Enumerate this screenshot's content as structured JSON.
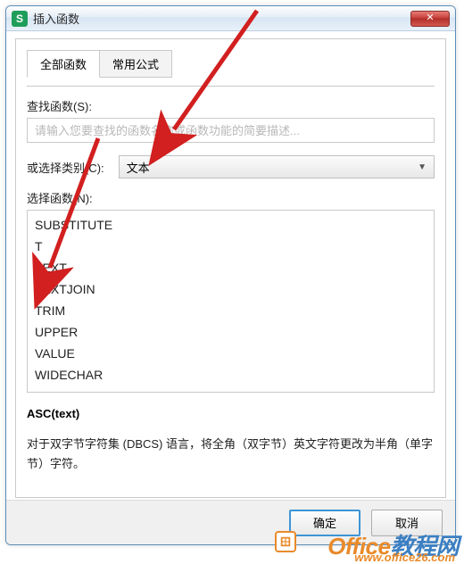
{
  "window": {
    "title": "插入函数",
    "app_icon_letter": "S"
  },
  "tabs": {
    "all": "全部函数",
    "common": "常用公式"
  },
  "search": {
    "label": "查找函数(S):",
    "placeholder": "请输入您要查找的函数名称或函数功能的简要描述..."
  },
  "category": {
    "label": "或选择类别(C):",
    "value": "文本"
  },
  "function_select": {
    "label": "选择函数(N):"
  },
  "functions": [
    "SUBSTITUTE",
    "T",
    "TEXT",
    "TEXTJOIN",
    "TRIM",
    "UPPER",
    "VALUE",
    "WIDECHAR"
  ],
  "signature": "ASC(text)",
  "description": "对于双字节字符集 (DBCS) 语言，将全角（双字节）英文字符更改为半角（单字节）字符。",
  "buttons": {
    "ok": "确定",
    "cancel": "取消"
  },
  "watermark": {
    "part1": "Office",
    "part2": "教程网",
    "url": "www.office26.com"
  }
}
